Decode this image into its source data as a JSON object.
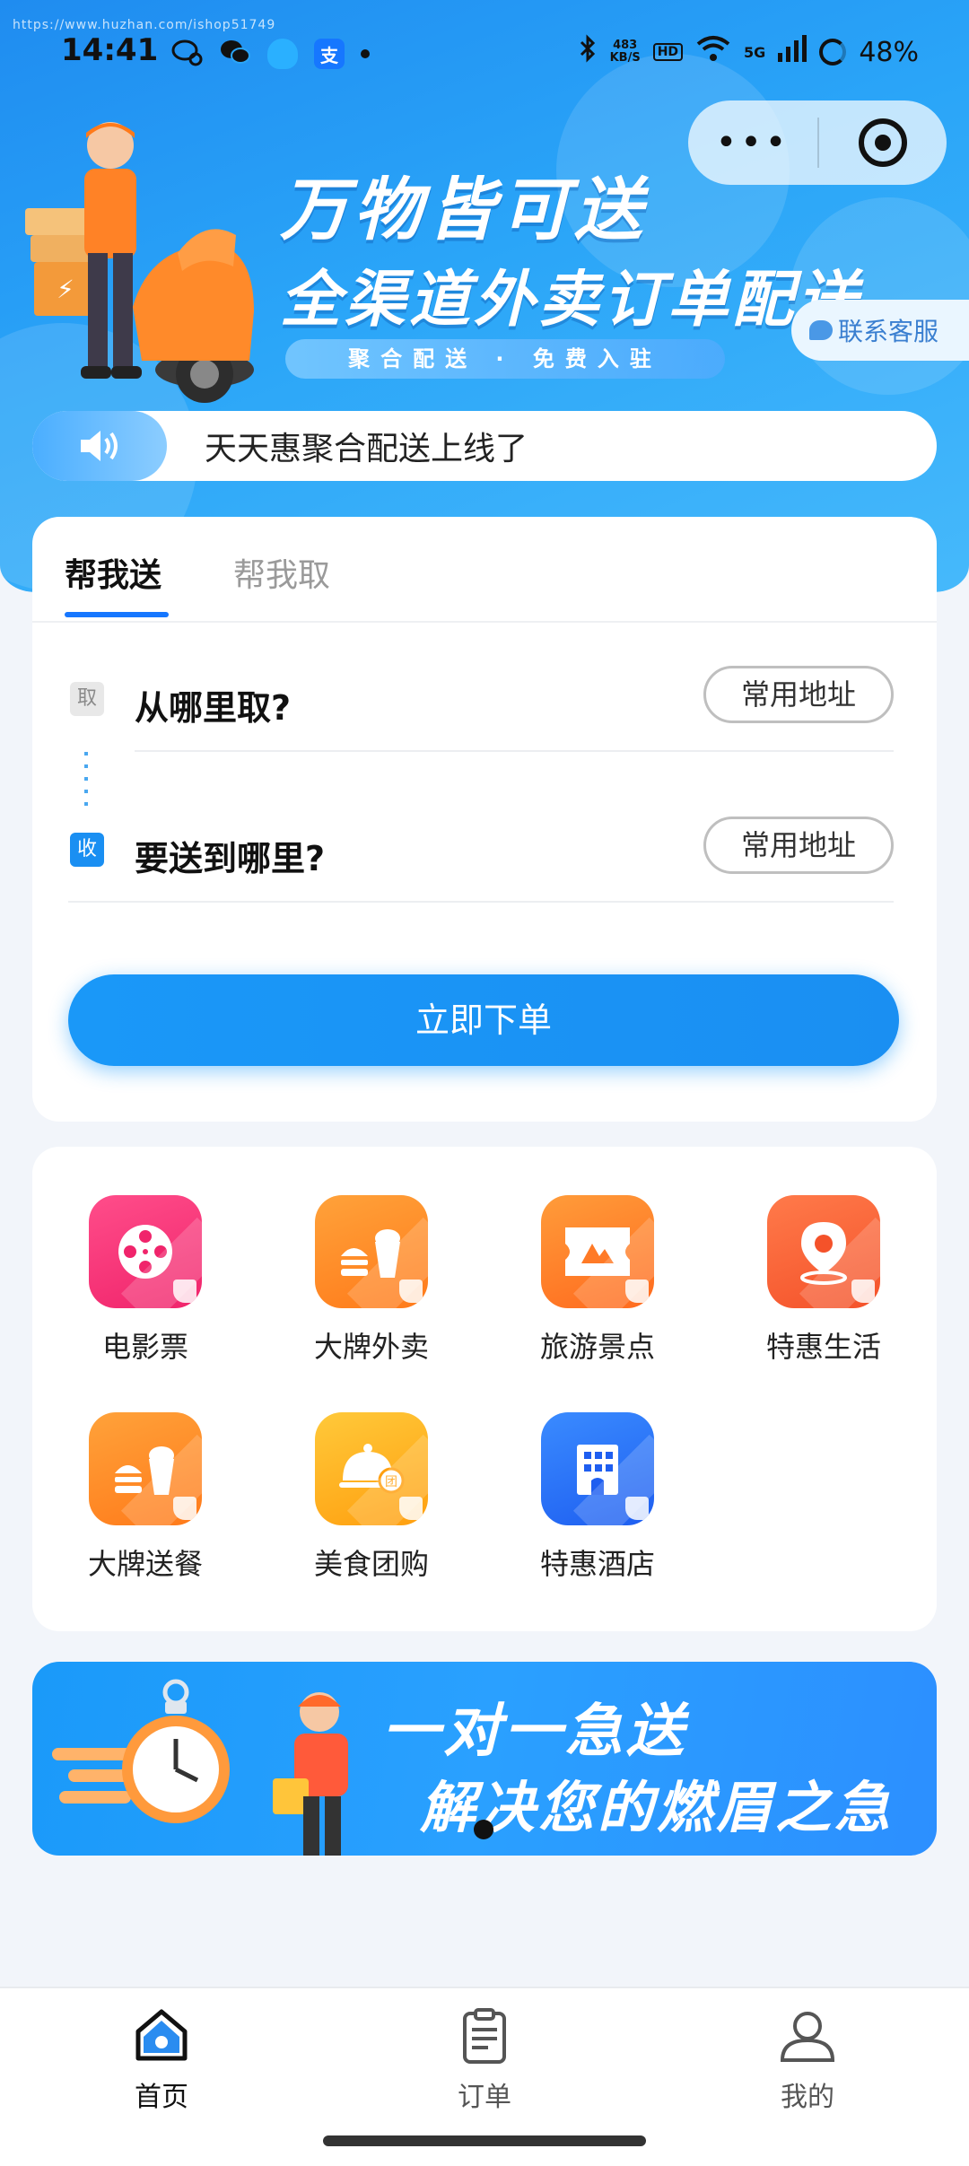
{
  "status_bar": {
    "watermark": "https://www.huzhan.com/ishop51749",
    "time": "14:41",
    "net_speed_value": "483",
    "net_speed_unit": "KB/S",
    "hd": "HD",
    "signal": "5G",
    "battery": "48%"
  },
  "capsule": {
    "more_icon": "more-dots-icon",
    "close_icon": "target-icon"
  },
  "hero": {
    "title": "万物皆可送",
    "subtitle": "全渠道外卖订单配送",
    "pill": "聚合配送 · 免费入驻",
    "service": "联系客服"
  },
  "notice": {
    "text": "天天惠聚合配送上线了"
  },
  "order_card": {
    "tabs": [
      "帮我送",
      "帮我取"
    ],
    "pickup": {
      "tag": "取",
      "question": "从哪里取?",
      "button": "常用地址"
    },
    "dropoff": {
      "tag": "收",
      "question": "要送到哪里?",
      "button": "常用地址"
    },
    "submit": "立即下单"
  },
  "services": [
    {
      "label": "电影票",
      "icon": "film-reel-icon",
      "color_from": "#ff4d8a",
      "color_to": "#f0246b"
    },
    {
      "label": "大牌外卖",
      "icon": "burger-drink-icon",
      "color_from": "#ffa23a",
      "color_to": "#ff7a1a"
    },
    {
      "label": "旅游景点",
      "icon": "ticket-mountain-icon",
      "color_from": "#ff9c3a",
      "color_to": "#ff6a1e"
    },
    {
      "label": "特惠生活",
      "icon": "location-pin-icon",
      "color_from": "#ff7a4a",
      "color_to": "#f4522a"
    },
    {
      "label": "大牌送餐",
      "icon": "burger-drink-icon",
      "color_from": "#ffa23a",
      "color_to": "#ff7a1a"
    },
    {
      "label": "美食团购",
      "icon": "food-cloche-icon",
      "color_from": "#ffc93a",
      "color_to": "#ff9f0f"
    },
    {
      "label": "特惠酒店",
      "icon": "hotel-building-icon",
      "color_from": "#3a8bff",
      "color_to": "#1e5ef0"
    }
  ],
  "banner": {
    "line1": "一对一急送",
    "line2": "解决您的燃眉之急"
  },
  "tabbar": [
    {
      "label": "首页",
      "icon": "home-icon",
      "active": true
    },
    {
      "label": "订单",
      "icon": "clipboard-icon",
      "active": false
    },
    {
      "label": "我的",
      "icon": "user-icon",
      "active": false
    }
  ],
  "colors": {
    "primary": "#1a98f8",
    "accent_tab": "#1677ff"
  }
}
